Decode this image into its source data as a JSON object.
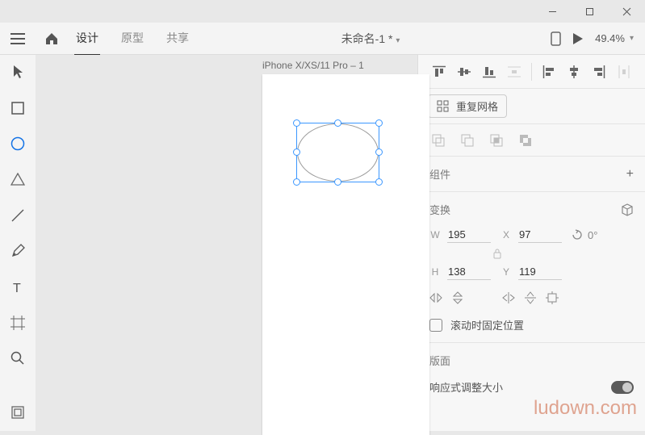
{
  "window": {
    "minimize": "–",
    "maximize": "□",
    "close": "×"
  },
  "topbar": {
    "tabs": {
      "design": "设计",
      "prototype": "原型",
      "share": "共享"
    },
    "doc_title": "未命名-1 *",
    "zoom": "49.4%"
  },
  "canvas": {
    "artboard_label": "iPhone X/XS/11 Pro – 1"
  },
  "panel": {
    "repeat_grid": "重复网格",
    "component": {
      "title": "组件"
    },
    "transform": {
      "title": "变换",
      "w_label": "W",
      "w": "195",
      "h_label": "H",
      "h": "138",
      "x_label": "X",
      "x": "97",
      "y_label": "Y",
      "y": "119",
      "rotation": "0°"
    },
    "fix_scroll": "滚动时固定位置",
    "layout": {
      "title": "版面",
      "responsive": "响应式调整大小"
    }
  },
  "watermark": "ludown.com"
}
